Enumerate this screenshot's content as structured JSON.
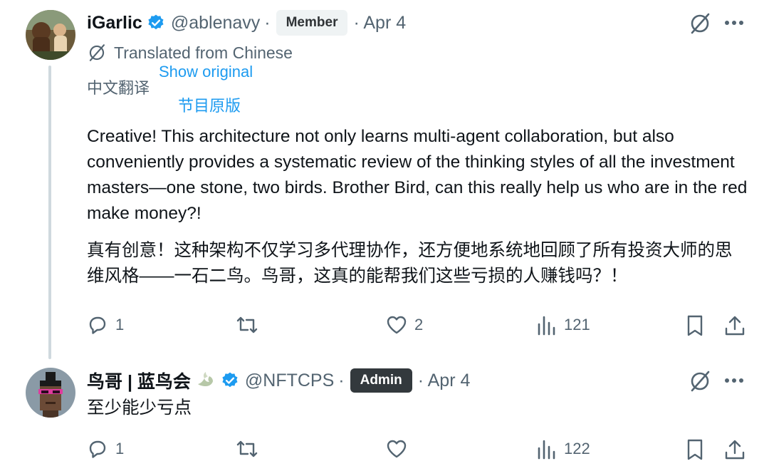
{
  "post1": {
    "name": "iGarlic",
    "handle": "@ablenavy",
    "dot": "·",
    "badge": "Member",
    "date": "· Apr 4",
    "translated_label": "Translated from Chinese",
    "translation_sub": "中文翻译",
    "show_original": "Show original",
    "program_original": "节目原版",
    "text_en": "Creative! This architecture not only learns multi-agent collaboration, but also conveniently provides a systematic review of the thinking styles of all the investment masters—one stone, two birds. Brother Bird, can this really help us who are in the red make money?!",
    "text_zh": "真有创意！这种架构不仅学习多代理协作，还方便地系统地回顾了所有投资大师的思维风格——一石二鸟。鸟哥，这真的能帮我们这些亏损的人赚钱吗？！",
    "replies": "1",
    "likes": "2",
    "views": "121"
  },
  "post2": {
    "name": "鸟哥 | 蓝鸟会",
    "handle": "@NFTCPS",
    "dot": "·",
    "badge": "Admin",
    "date": "· Apr 4",
    "text": "至少能少亏点",
    "replies": "1",
    "views": "122"
  },
  "colors": {
    "verified": "#1d9bf0",
    "link": "#1d9bf0",
    "secondary": "#536471",
    "thread_line": "#cfd9de"
  }
}
